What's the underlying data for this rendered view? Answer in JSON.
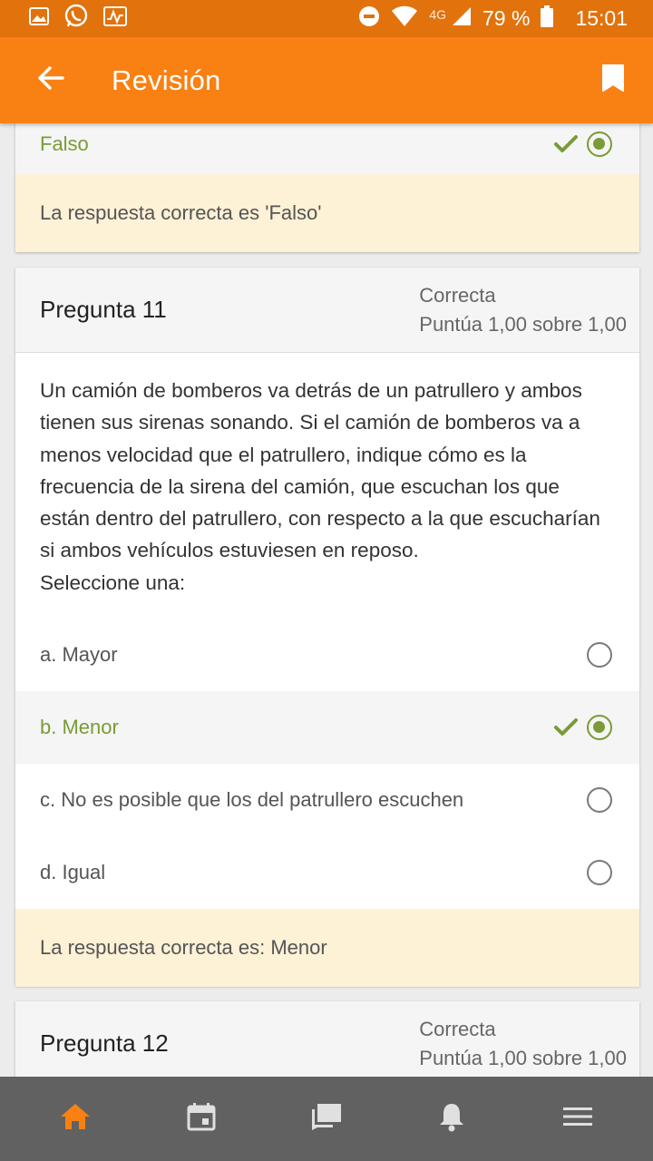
{
  "status_bar": {
    "network": "4G",
    "battery": "79 %",
    "time": "15:01"
  },
  "app_bar": {
    "title": "Revisión"
  },
  "previous_question": {
    "selected_option": "Falso",
    "feedback": "La respuesta correcta es 'Falso'"
  },
  "question_11": {
    "title": "Pregunta 11",
    "status": "Correcta",
    "score": "Puntúa 1,00 sobre 1,00",
    "text": "Un camión de bomberos va detrás de un patrullero y ambos tienen sus sirenas sonando. Si el camión de bomberos va a menos velocidad que el patrullero, indique cómo es la frecuencia de la sirena del camión, que escuchan los que están dentro del patrullero, con respecto a la que escucharían si ambos vehículos estuviesen en reposo.",
    "instruction": "Seleccione una:",
    "options": [
      {
        "label": "a. Mayor",
        "selected": false
      },
      {
        "label": "b. Menor",
        "selected": true
      },
      {
        "label": "c. No es posible que los del patrullero escuchen",
        "selected": false
      },
      {
        "label": "d. Igual",
        "selected": false
      }
    ],
    "feedback": "La respuesta correcta es: Menor"
  },
  "question_12": {
    "title": "Pregunta 12",
    "status": "Correcta",
    "score": "Puntúa 1,00 sobre 1,00"
  },
  "bottom_nav": {
    "items": [
      "home-icon",
      "calendar-icon",
      "messages-icon",
      "notifications-icon",
      "menu-icon"
    ]
  },
  "colors": {
    "status_bar": "#e2720c",
    "app_bar": "#f98113",
    "correct_green": "#7a9b35",
    "feedback_bg": "#fdf1d6",
    "bottom_nav": "#616161",
    "nav_active": "#f98113"
  }
}
